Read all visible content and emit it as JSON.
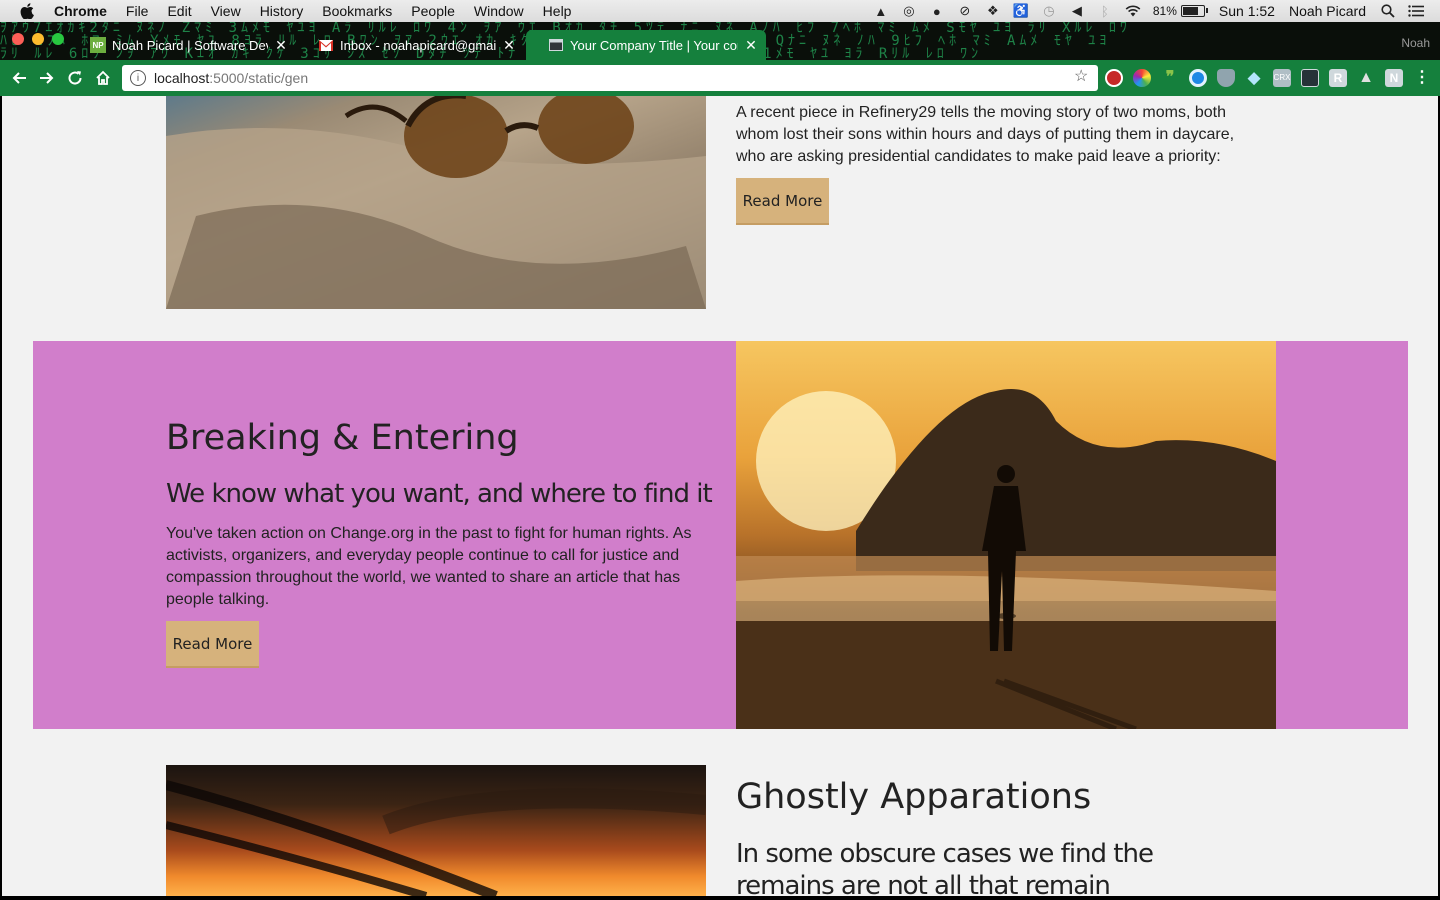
{
  "menubar": {
    "app_name": "Chrome",
    "items": [
      "File",
      "Edit",
      "View",
      "History",
      "Bookmarks",
      "People",
      "Window",
      "Help"
    ],
    "battery_percent": "81%",
    "battery_level": 0.81,
    "clock": "Sun 1:52",
    "user": "Noah Picard"
  },
  "browser": {
    "tabs": [
      {
        "title": "Noah Picard | Software Develo",
        "favicon": "np-favicon",
        "favicon_text": "NP"
      },
      {
        "title": "Inbox - noahapicard@gmail.co",
        "favicon": "gmail-icon"
      },
      {
        "title": "Your Company Title | Your com",
        "favicon": "page-icon",
        "active": true
      }
    ],
    "profile_name": "Noah",
    "url_host": "localhost",
    "url_path": ":5000/static/gen",
    "accent_color": "#15803d"
  },
  "page": {
    "article1": {
      "text": "A recent piece in Refinery29 tells the moving story of two moms, both whom lost their sons within hours and days of putting them in daycare, who are asking presidential candidates to make paid leave a priority:",
      "button": "Read More",
      "image": "sunglasses-on-rock-photo"
    },
    "article2": {
      "title": "Breaking & Entering",
      "subtitle": "We know what you want, and where to find it",
      "text": "You've taken action on Change.org in the past to fight for human rights. As activists, organizers, and everyday people continue to call for justice and compassion throughout the world, we wanted to share an article that has people talking.",
      "button": "Read More",
      "image": "beach-sunset-silhouette-photo",
      "band_color": "#d17ecb"
    },
    "article3": {
      "title": "Ghostly Apparations",
      "subtitle": "In some obscure cases we find the remains are not all that remain",
      "image": "sunset-contrails-photo"
    },
    "button_color": "#d6b27c"
  }
}
